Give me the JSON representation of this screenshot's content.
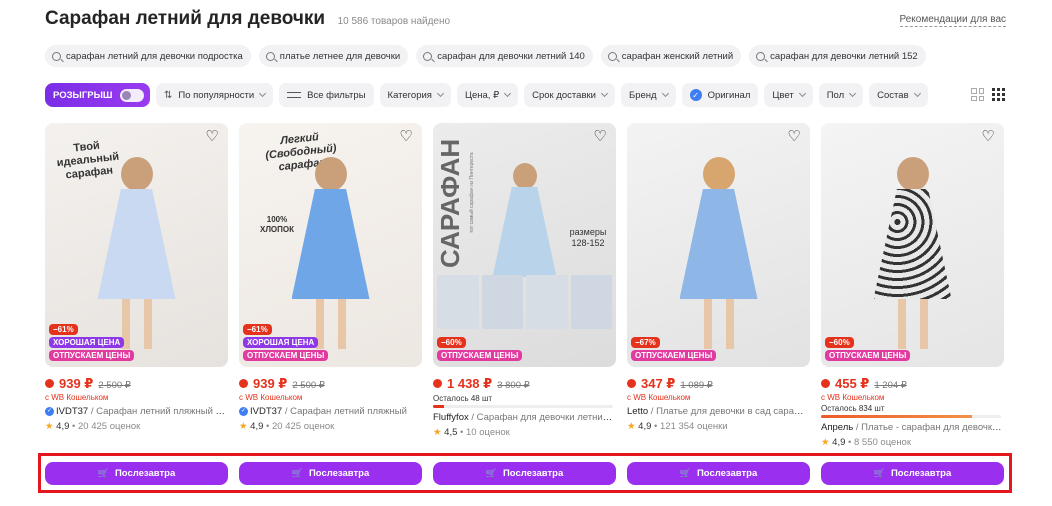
{
  "header": {
    "title": "Сарафан летний для девочки",
    "count": "10 586 товаров найдено",
    "recommendations": "Рекомендации для вас"
  },
  "suggestions": [
    "сарафан летний для девочки подростка",
    "платье летнее для девочки",
    "сарафан для девочки летний 140",
    "сарафан женский летний",
    "сарафан для девочки летний 152"
  ],
  "filters": {
    "promo": "РОЗЫГРЫШ",
    "sort": "По популярности",
    "all_filters": "Все фильтры",
    "category": "Категория",
    "price": "Цена, ₽",
    "delivery": "Срок доставки",
    "brand": "Бренд",
    "original": "Оригинал",
    "color": "Цвет",
    "gender": "Пол",
    "composition": "Состав"
  },
  "products": [
    {
      "discount": "−61%",
      "good_price": "ХОРОШАЯ ЦЕНА",
      "release": "ОТПУСКАЕМ ЦЕНЫ",
      "price": "939 ₽",
      "old_price": "2 500 ₽",
      "wallet": "с WB Кошельком",
      "brand": "IVDT37",
      "name": "Сарафан летний пляжный на...",
      "rating": "4,9",
      "reviews": "20 425 оценок",
      "overlay": "Твой идеальный сарафан",
      "dress_color": "#c9d9f2"
    },
    {
      "discount": "−61%",
      "good_price": "ХОРОШАЯ ЦЕНА",
      "release": "ОТПУСКАЕМ ЦЕНЫ",
      "price": "939 ₽",
      "old_price": "2 500 ₽",
      "wallet": "с WB Кошельком",
      "brand": "IVDT37",
      "name": "Сарафан летний пляжный",
      "rating": "4,9",
      "reviews": "20 425 оценок",
      "overlay": "Легкий (Свободный) сарафан",
      "overlay2": "100% ХЛОПОК",
      "dress_color": "#6fa6e8"
    },
    {
      "discount": "−60%",
      "release": "ОТПУСКАЕМ ЦЕНЫ",
      "price": "1 438 ₽",
      "old_price": "3 800 ₽",
      "stock": "Осталось 48 шт",
      "stock_level": 0.06,
      "brand": "Fluffyfox",
      "name": "Сарафан для девочки летний ...",
      "rating": "4,5",
      "reviews": "10 оценок",
      "overlay": "САРАФАН",
      "overlay_sub": "тот самый сарафан из Пинтереста",
      "overlay2": "размеры 128-152",
      "dress_color": "#b9d4ea"
    },
    {
      "discount": "−67%",
      "release": "ОТПУСКАЕМ ЦЕНЫ",
      "price": "347 ₽",
      "old_price": "1 089 ₽",
      "wallet": "с WB Кошельком",
      "brand": "Letto",
      "name": "Платье для девочки в сад сарафан...",
      "rating": "4,9",
      "reviews": "121 354 оценки",
      "dress_color": "#8eb6e6"
    },
    {
      "discount": "−60%",
      "release": "ОТПУСКАЕМ ЦЕНЫ",
      "price": "455 ₽",
      "old_price": "1 204 ₽",
      "wallet": "с WB Кошельком",
      "stock": "Осталось 834 шт",
      "stock_level": 0.84,
      "brand": "Апрель",
      "name": "Платье - сарафан для девочки...",
      "rating": "4,9",
      "reviews": "8 550 оценок",
      "dress_color": "#d8d8d8"
    }
  ],
  "buy_label": "Послезавтра",
  "colors": {
    "accent": "#9a2ff0",
    "price": "#e5321c",
    "highlight": "#e4161e"
  }
}
